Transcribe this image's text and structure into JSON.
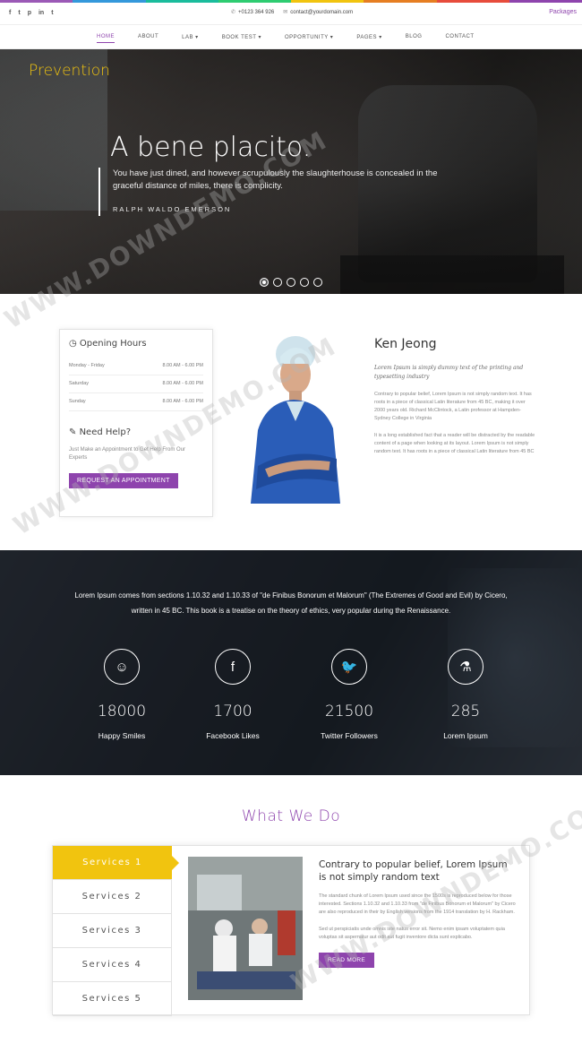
{
  "rainbow": [
    "#9b59b6",
    "#3498db",
    "#1abc9c",
    "#2ecc71",
    "#f1c40f",
    "#e67e22",
    "#e74c3c",
    "#8e44ad"
  ],
  "topbar": {
    "social": [
      "f",
      "t",
      "p",
      "in",
      "t"
    ],
    "social_names": [
      "facebook-icon",
      "twitter-icon",
      "pinterest-icon",
      "linkedin-icon",
      "tumblr-icon"
    ],
    "phone": "+0123 364 926",
    "email": "contact@yourdomain.com",
    "packages": "Packages"
  },
  "nav": [
    "HOME",
    "ABOUT",
    "LAB ▾",
    "BOOK TEST ▾",
    "OPPORTUNITY ▾",
    "PAGES ▾",
    "BLOG",
    "CONTACT"
  ],
  "hero": {
    "tag": "Prevention",
    "title": "A bene placito.",
    "quote": "You have just dined, and however scrupulously the slaughterhouse is concealed in the graceful distance of miles, there is complicity.",
    "author": "Ralph Waldo Emerson",
    "slides": 5,
    "active_slide": 0
  },
  "hours": {
    "title": "Opening Hours",
    "rows": [
      {
        "day": "Monday - Friday",
        "time": "8.00 AM - 6.00 PM"
      },
      {
        "day": "Saturday",
        "time": "8.00 AM - 6.00 PM"
      },
      {
        "day": "Sunday",
        "time": "8.00 AM - 6.00 PM"
      }
    ],
    "help_title": "Need Help?",
    "help_text": "Just Make an Appointment to Get Help From Our Experts",
    "button": "REQUEST AN APPOINTMENT"
  },
  "profile": {
    "name": "Ken Jeong",
    "subtitle": "Lorem Ipsum is simply dummy text of the printing and typesetting industry",
    "p1": "Contrary to popular belief, Lorem Ipsum is not simply random text. It has roots in a piece of classical Latin literature from 45 BC, making it over 2000 years old. Richard McClintock, a Latin professor at Hampden-Sydney College in Virginia",
    "p2": "It is a long established fact that a reader will be distracted by the readable content of a page when looking at its layout. Lorem Ipsum is not simply random text. It has roots in a piece of classical Latin literature from 45 BC"
  },
  "stats": {
    "text": "Lorem Ipsum comes from sections 1.10.32 and 1.10.33 of \"de Finibus Bonorum et Malorum\" (The Extremes of Good and Evil) by Cicero, written in 45 BC. This book is a treatise on the theory of ethics, very popular during the Renaissance.",
    "items": [
      {
        "icon": "smile-icon",
        "glyph": "☺",
        "num": "18000",
        "label": "Happy Smiles"
      },
      {
        "icon": "facebook-icon",
        "glyph": "f",
        "num": "1700",
        "label": "Facebook Likes"
      },
      {
        "icon": "twitter-icon",
        "glyph": "🐦",
        "num": "21500",
        "label": "Twitter Followers"
      },
      {
        "icon": "flask-icon",
        "glyph": "⚗",
        "num": "285",
        "label": "Lorem Ipsum"
      }
    ]
  },
  "services": {
    "title": "What We Do",
    "tabs": [
      "Services 1",
      "Services 2",
      "Services 3",
      "Services 4",
      "Services 5"
    ],
    "active_tab": 0,
    "heading": "Contrary to popular belief, Lorem Ipsum is not simply random text",
    "p1": "The standard chunk of Lorem Ipsum used since the 1500s is reproduced below for those interested. Sections 1.10.32 and 1.10.33 from \"de Finibus Bonorum et Malorum\" by Cicero are also reproduced in their by English versions from the 1914 translation by H. Rackham.",
    "p2": "Sed ut perspiciatis unde omnis iste natus error sit. Nemo enim ipsam voluptatem quia voluptas sit aspernatur aut odit aut fugit inventore dicta sunt explicabo.",
    "button": "READ MORE"
  },
  "watermark": "WWW.DOWNDEMO.COM",
  "colors": {
    "accent": "#8e44ad",
    "yellow": "#f1c40f"
  }
}
